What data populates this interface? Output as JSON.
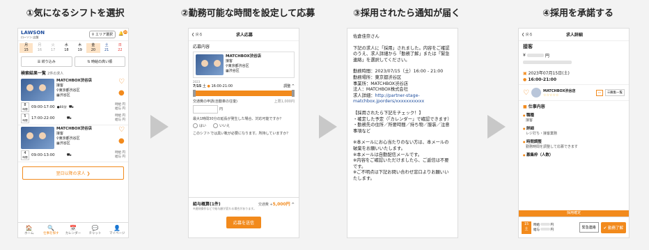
{
  "steps": [
    {
      "title": "①気になるシフトを選択"
    },
    {
      "title": "②勤務可能な時間を設定して応募"
    },
    {
      "title": "③採用されたら通知が届く"
    },
    {
      "title": "④採用を承諾する"
    }
  ],
  "colors": {
    "accent": "#f28a1c",
    "brand": "#1d4c9c"
  },
  "phone1": {
    "logo": "LAWSON",
    "logo_sub": "ローソン 店舗",
    "area_button": "エリア選択",
    "bell_badge": "10",
    "calendar": [
      {
        "dow": "月",
        "d": "15"
      },
      {
        "dow": "月",
        "d": "16"
      },
      {
        "dow": "火",
        "d": "17"
      },
      {
        "dow": "水",
        "d": "18"
      },
      {
        "dow": "木",
        "d": "19"
      },
      {
        "dow": "金",
        "d": "20"
      },
      {
        "dow": "土",
        "d": "21"
      },
      {
        "dow": "日",
        "d": "22"
      }
    ],
    "filter_btn": "絞り込み",
    "sort_btn": "時給の高い順",
    "results_label": "検索結果一覧",
    "results_count": "2件の求人",
    "jobs": [
      {
        "store": "MATCHBOX渋谷店",
        "role": "接客",
        "address": "東京都渋谷区",
        "ward": "渋谷区",
        "shifts": [
          {
            "cnt": "8",
            "unit": "時間",
            "time": "09:00-17:00",
            "note": "●60分",
            "wage1": "時給",
            "wage2": "給与",
            "yen": "円"
          },
          {
            "cnt": "5",
            "unit": "時間",
            "time": "17:00-22:00",
            "note": "",
            "wage1": "時給",
            "wage2": "給与",
            "yen": "円"
          }
        ]
      },
      {
        "store": "MATCHBOX渋谷店",
        "role": "接客",
        "address": "東京都渋谷区",
        "ward": "渋谷区",
        "shifts": [
          {
            "cnt": "4",
            "unit": "時間",
            "time": "09:00-13:00",
            "note": "",
            "wage1": "時給",
            "wage2": "給与",
            "yen": "円"
          }
        ]
      }
    ],
    "more_button": "翌日以降の求人 ❯",
    "tabs": [
      {
        "icon": "🏠",
        "label": "ホーム"
      },
      {
        "icon": "🔍",
        "label": "仕事を探す"
      },
      {
        "icon": "📅",
        "label": "カレンダー"
      },
      {
        "icon": "💬",
        "label": "チャット"
      },
      {
        "icon": "👤",
        "label": "マイページ"
      }
    ]
  },
  "phone2": {
    "back": "戻る",
    "title": "求人応募",
    "section": "応募内容",
    "store": "MATCHBOX渋谷店",
    "role": "接客",
    "address": "東京都渋谷区",
    "ward": "渋谷区",
    "year": "2023",
    "date": "7/15",
    "dow": "土",
    "time": "16:00-21:00",
    "adjust": "調整 ^",
    "q1": "交通費の申請(自動車の往復)",
    "q1_limit": "上限1,000円",
    "yen": "円",
    "q2": "最大1時間30分の延長が発生した場合、対応可能ですか？",
    "opt_yes": "はい",
    "opt_no": "いいえ",
    "q3": "このシフトでは黒い靴が必要になります。所持していますか？",
    "pay_label": "給与概算(1件)",
    "transport": "交通費 +",
    "pay_value": "5,000円",
    "pay_note": "※遅刻操作などで給与額が変わる場合があります。",
    "apply_button": "応募を送信"
  },
  "phone3": {
    "greeting": "佐倉佳奈さん",
    "p1": "下記の求人に「採用」されました。内容をご確認のうえ、求人詳細から「勤務了解」または「緊急連絡」を選択してください。",
    "line1": "勤務時間：2023/07/15（土）16:00 - 21:00",
    "line2": "勤務場所：東京都渋谷区",
    "line3": "事業所：MATCHBOX渋谷店",
    "line4": "法人：MATCHBOX株式会社",
    "line5_label": "求人詳細：",
    "line5_link": "http://partner-stage-matchbox.jporders/xxxxxxxxxxx",
    "check1": "【採用されたら下記をチェック！】",
    "check2": "・確定した予定（「カレンダー」で確認できます）",
    "check3": "・勤務先の住所／所要時間／持ち物／服装／注意事項など",
    "note1": "※本メールにお心当たりのない方は、本メールの破棄をお願いいたします。",
    "note2": "※本メールは自動配信メールです。",
    "note3": "※内容をご確認いただけましたら、ご返信は不要です。",
    "note4": "※ご不明点は下記お問い合わせ窓口よりお願いいたします。"
  },
  "phone4": {
    "back": "戻る",
    "title": "求人詳細",
    "role": "接客",
    "yen_mark": "¥",
    "yen": "円",
    "date": "2023年07月15日(土)",
    "time": "16:00-21:00",
    "store": "MATCHBOX渋谷店",
    "stars": "☆☆☆☆☆",
    "list_btn": "募集一覧",
    "section": "仕事内容",
    "items": [
      {
        "h": "職種",
        "v": "接客"
      },
      {
        "h": "詳細",
        "v": "レジ打ち・接客業務"
      },
      {
        "h": "時間調整",
        "v": "勤務時間を調整して応募できます"
      },
      {
        "h": "募集枠（人数）",
        "v": ""
      }
    ],
    "banner": "採用確定",
    "date_badge_num": "15",
    "date_badge_dow": "土",
    "wage1": "時給",
    "wage2": "給与",
    "urgent_btn": "緊急連絡",
    "accept_btn": "✔ 勤務了解"
  }
}
